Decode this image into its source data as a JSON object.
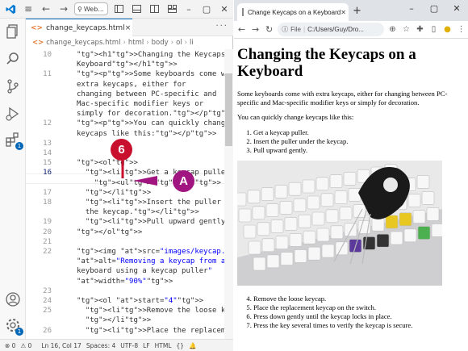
{
  "vscode": {
    "search_text": "Web...",
    "tab": {
      "icon": "<>",
      "label": "change_keycaps.html",
      "close": "×"
    },
    "breadcrumb": {
      "icon": "<>",
      "items": [
        "change_keycaps.html",
        "html",
        "body",
        "ol",
        "li"
      ]
    },
    "lines": [
      {
        "n": "10",
        "code": "<h1>Changing the Keycaps on a"
      },
      {
        "n": "",
        "code": "Keyboard</h1>"
      },
      {
        "n": "11",
        "code": "<p>Some keyboards come with"
      },
      {
        "n": "",
        "code": "extra keycaps, either for"
      },
      {
        "n": "",
        "code": "changing between PC-specific and"
      },
      {
        "n": "",
        "code": "Mac-specific modifier keys or"
      },
      {
        "n": "",
        "code": "simply for decoration.</p>"
      },
      {
        "n": "12",
        "code": "<p>You can quickly change"
      },
      {
        "n": "",
        "code": "keycaps like this:</p>"
      },
      {
        "n": "13",
        "code": ""
      },
      {
        "n": "14",
        "code": ""
      },
      {
        "n": "15",
        "code": "<ol>"
      },
      {
        "n": "16",
        "code": "  <li>Get a keycap puller."
      },
      {
        "n": "",
        "code": "    <ul></ul>"
      },
      {
        "n": "17",
        "code": "  </li>"
      },
      {
        "n": "18",
        "code": "  <li>Insert the puller under"
      },
      {
        "n": "",
        "code": "  the keycap.</li>"
      },
      {
        "n": "19",
        "code": "  <li>Pull upward gently.</li>"
      },
      {
        "n": "20",
        "code": "</ol>"
      },
      {
        "n": "21",
        "code": ""
      },
      {
        "n": "22",
        "code": "<img src=\"images/keycap.jpeg\""
      },
      {
        "n": "",
        "code": "alt=\"Removing a keycap from a"
      },
      {
        "n": "",
        "code": "keyboard using a keycap puller\""
      },
      {
        "n": "",
        "code": "width=\"90%\">"
      },
      {
        "n": "23",
        "code": ""
      },
      {
        "n": "24",
        "code": "<ol start=\"4\">"
      },
      {
        "n": "25",
        "code": "  <li>Remove the loose keycap."
      },
      {
        "n": "",
        "code": "  </li>"
      },
      {
        "n": "26",
        "code": "  <li>Place the replacement"
      }
    ],
    "callout_step": "6",
    "callout_letter": "A",
    "status": {
      "errors": "⊗ 0",
      "warnings": "⚠ 0",
      "position": "Ln 16, Col 17",
      "spaces": "Spaces: 4",
      "encoding": "UTF-8",
      "eol": "LF",
      "language": "HTML"
    },
    "badge_count": "1"
  },
  "browser": {
    "tab_title": "Change Keycaps on a Keyboard",
    "file_label": "File",
    "url": "C:/Users/Guy/Dro...",
    "page": {
      "heading": "Changing the Keycaps on a Keyboard",
      "p1": "Some keyboards come with extra keycaps, either for changing between PC-specific and Mac-specific modifier keys or simply for decoration.",
      "p2": "You can quickly change keycaps like this:",
      "list1": [
        "Get a keycap puller.",
        "Insert the puller under the keycap.",
        "Pull upward gently."
      ],
      "list2": [
        "Remove the loose keycap.",
        "Place the replacement keycap on the switch.",
        "Press down gently until the keycap locks in place.",
        "Press the key several times to verify the keycap is secure."
      ]
    }
  },
  "colors": {
    "accent": "#0066b8",
    "callout_step": "#c8102e",
    "callout_letter": "#a0157f",
    "tag": "#800000",
    "attribute": "#e50000",
    "string": "#0000ff"
  }
}
